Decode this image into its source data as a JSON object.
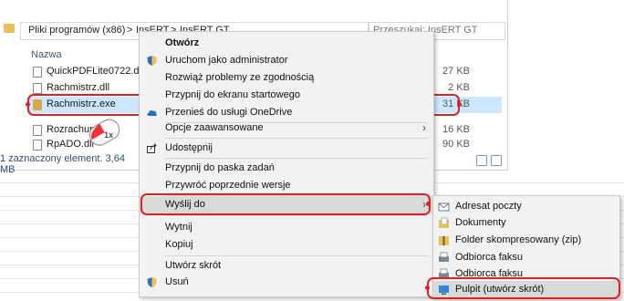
{
  "explorer": {
    "breadcrumb": [
      "Pliki programów (x86)",
      ">",
      "InsERT",
      ">",
      "InsERT GT"
    ],
    "search_placeholder": "Przeszukaj: InsERT GT",
    "column_name": "Nazwa",
    "files": [
      {
        "name": "QuickPDFLite0722.dll",
        "size": "27 KB"
      },
      {
        "name": "Rachmistrz.dll",
        "size": "2 KB"
      },
      {
        "name": "Rachmistrz.exe",
        "size": "31 KB"
      },
      {
        "name": "Rozrachunki",
        "size": "16 KB"
      },
      {
        "name": "RpADO.dll",
        "size": "90 KB"
      }
    ],
    "status": "1 zaznaczony element. 3,64 MB"
  },
  "mouse_badge": "1x",
  "context_menu": {
    "items": [
      {
        "label": "Otwórz"
      },
      {
        "label": "Uruchom jako administrator"
      },
      {
        "label": "Rozwiąż problemy ze zgodnością"
      },
      {
        "label": "Przypnij do ekranu startowego"
      },
      {
        "label": "Przenieś do usługi OneDrive"
      },
      {
        "label": "Opcje zaawansowane"
      },
      {
        "label": "Udostępnij"
      },
      {
        "label": "Przypnij do paska zadań"
      },
      {
        "label": "Przywróć poprzednie wersje"
      },
      {
        "label": "Wyślij do"
      },
      {
        "label": "Wytnij"
      },
      {
        "label": "Kopiuj"
      },
      {
        "label": "Utwórz skrót"
      },
      {
        "label": "Usuń"
      }
    ],
    "submenu_arrow": "›"
  },
  "send_to": {
    "items": [
      {
        "label": "Adresat poczty"
      },
      {
        "label": "Dokumenty"
      },
      {
        "label": "Folder skompresowany (zip)"
      },
      {
        "label": "Odbiorca faksu"
      },
      {
        "label": "Odbiorca faksu"
      },
      {
        "label": "Pulpit (utwórz skrót)"
      }
    ]
  },
  "colors": {
    "highlight": "#dd2222",
    "selection": "#cce8ff",
    "menu_bg": "#f2f2f2"
  }
}
